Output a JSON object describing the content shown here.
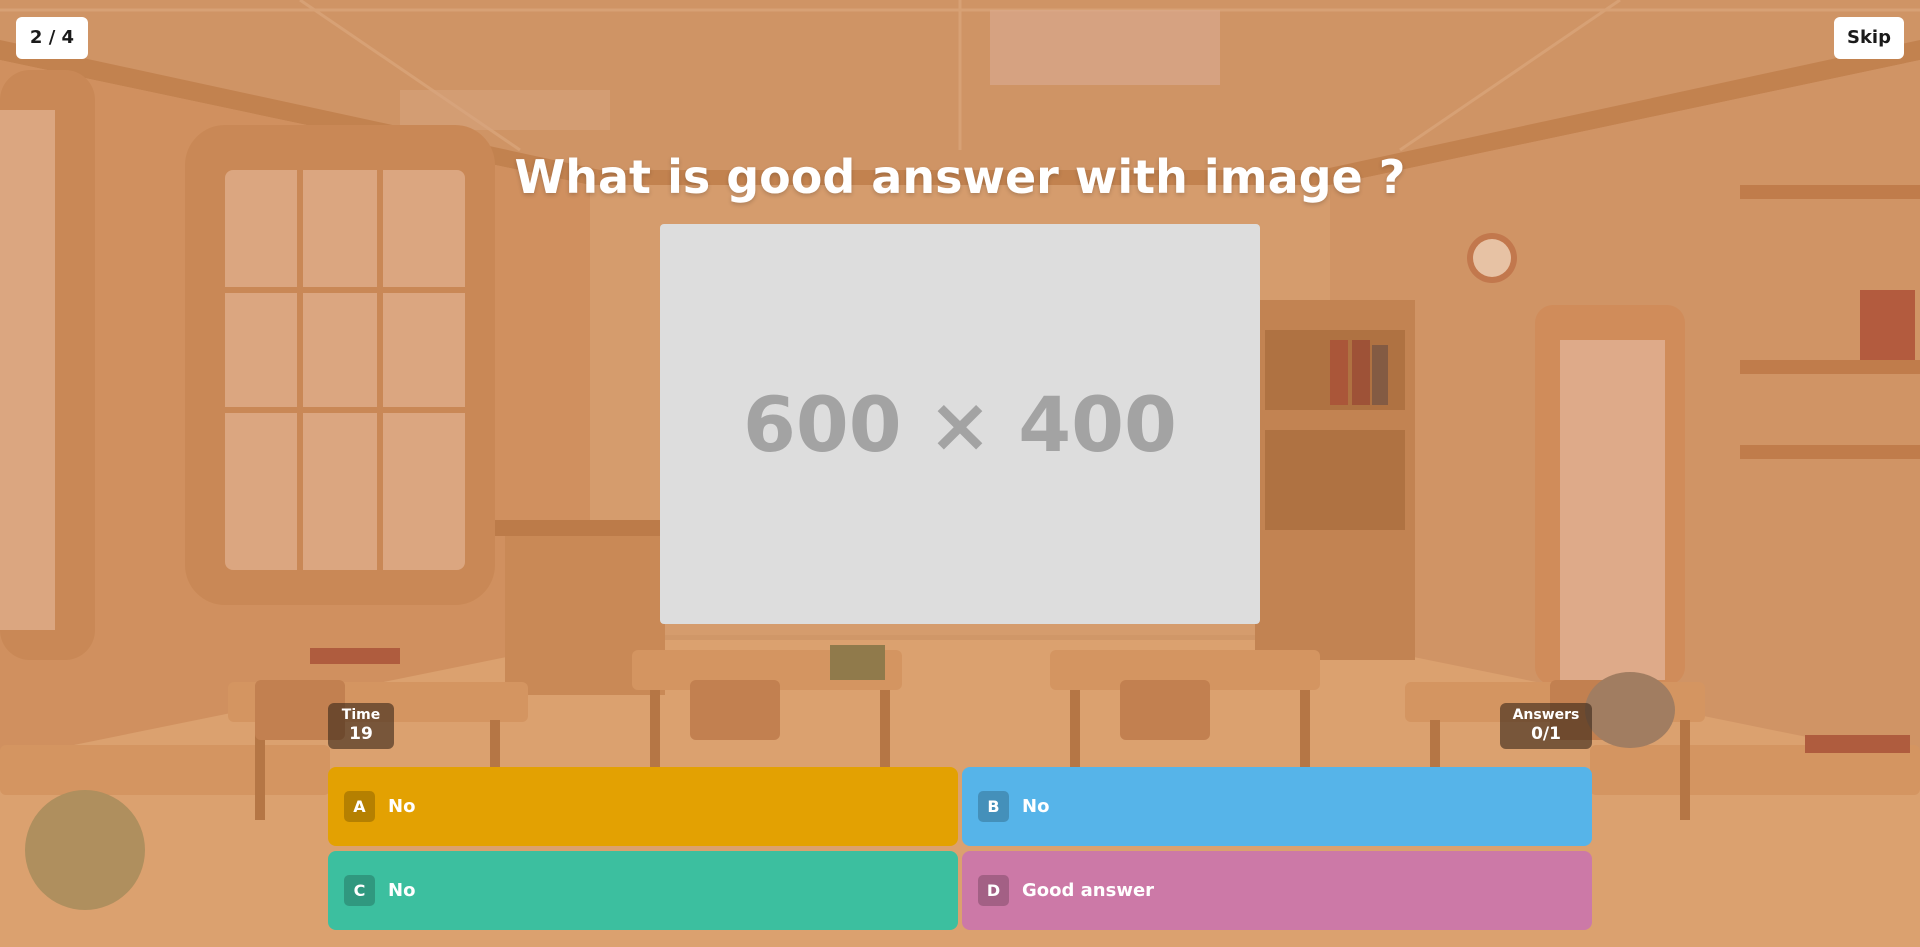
{
  "progress": {
    "label": "2 / 4"
  },
  "skip": {
    "label": "Skip"
  },
  "question": {
    "text": "What is good answer with image ?"
  },
  "image_placeholder": {
    "text": "600 × 400"
  },
  "stats": {
    "time": {
      "label": "Time",
      "value": "19"
    },
    "answers": {
      "label": "Answers",
      "value": "0/1"
    }
  },
  "answers": [
    {
      "letter": "A",
      "text": "No",
      "color": "#e3a102"
    },
    {
      "letter": "B",
      "text": "No",
      "color": "#56b4e9"
    },
    {
      "letter": "C",
      "text": "No",
      "color": "#3cbf9f"
    },
    {
      "letter": "D",
      "text": "Good answer",
      "color": "#cc79a7"
    }
  ]
}
